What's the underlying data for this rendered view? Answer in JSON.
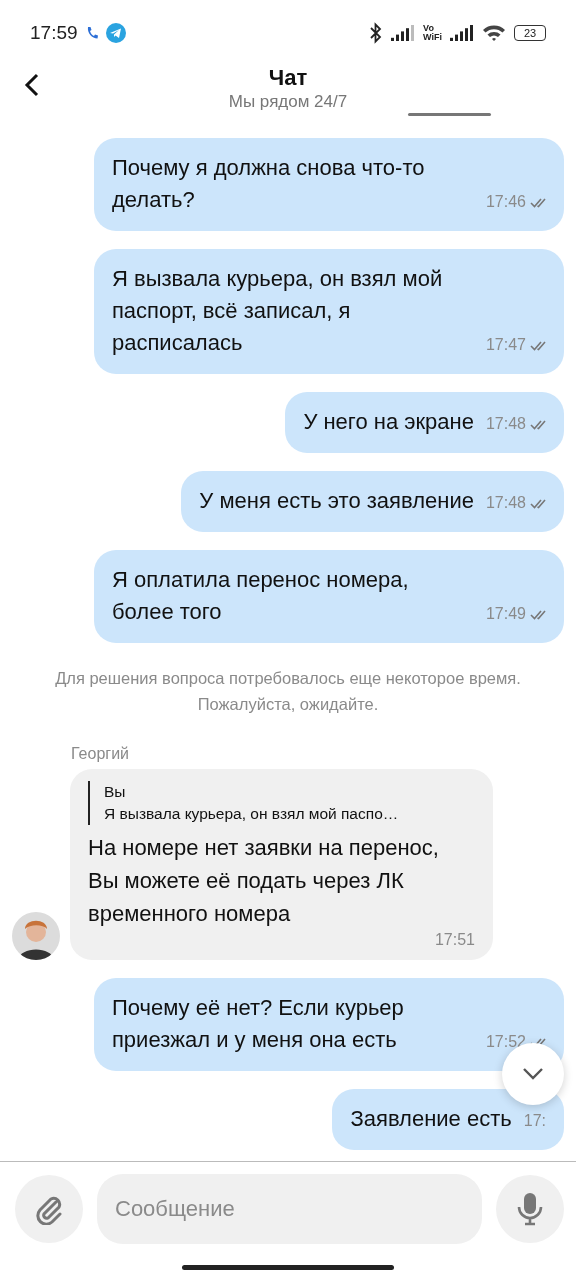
{
  "status_bar": {
    "time": "17:59",
    "vo_label": "Vo",
    "wifi_label": "WiFi",
    "battery": "23"
  },
  "header": {
    "title": "Чат",
    "subtitle": "Мы рядом 24/7"
  },
  "messages": [
    {
      "kind": "outgoing",
      "text": "Почему я должна снова что-то делать?",
      "time": "17:46",
      "read": true
    },
    {
      "kind": "outgoing",
      "text": "Я вызвала курьера, он взял мой паспорт, всё записал, я расписалась",
      "time": "17:47",
      "read": true
    },
    {
      "kind": "outgoing",
      "text": "У него на экране",
      "time": "17:48",
      "read": true
    },
    {
      "kind": "outgoing",
      "text": "У меня есть это заявление",
      "time": "17:48",
      "read": true
    },
    {
      "kind": "outgoing",
      "text": "Я оплатила перенос номера, более того",
      "time": "17:49",
      "read": true
    },
    {
      "kind": "system",
      "text": "Для решения вопроса потребовалось еще некоторое время. Пожалуйста, ожидайте."
    },
    {
      "kind": "incoming",
      "sender": "Георгий",
      "quote": {
        "author": "Вы",
        "text": "Я вызвала курьера, он взял мой паспо…"
      },
      "text": "На номере нет заявки на перенос, Вы можете её подать через ЛК временного номера",
      "time": "17:51"
    },
    {
      "kind": "outgoing",
      "text": "Почему её нет? Если курьер приезжал и у меня она есть",
      "time": "17:52",
      "read": true
    },
    {
      "kind": "outgoing",
      "text": "Заявление есть",
      "time": "17:"
    }
  ],
  "composer": {
    "placeholder": "Сообщение"
  }
}
